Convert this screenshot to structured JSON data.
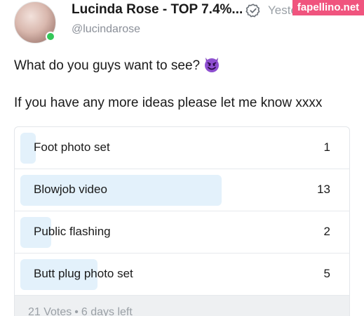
{
  "post": {
    "author_name": "Lucinda Rose - TOP 7.4%...",
    "username": "@lucindarose",
    "time": "Yeste",
    "verified_icon": "verified-check-icon",
    "text_line1": "What do you guys want to see?",
    "emoji": "smiling-devil-emoji",
    "text_line2": "If you have any more ideas please let me know xxxx"
  },
  "watermark": "fapellino.net",
  "poll": {
    "options": [
      {
        "label": "Foot photo set",
        "votes": "1"
      },
      {
        "label": "Blowjob video",
        "votes": "13"
      },
      {
        "label": "Public flashing",
        "votes": "2"
      },
      {
        "label": "Butt plug photo set",
        "votes": "5"
      }
    ],
    "total_votes": "21 Votes",
    "separator": "•",
    "time_left": "6 days left"
  },
  "colors": {
    "bar_fill": "#e3f1fb",
    "online": "#34c759",
    "watermark_bg": "#f0547e",
    "muted_text": "#9aa0a6"
  }
}
